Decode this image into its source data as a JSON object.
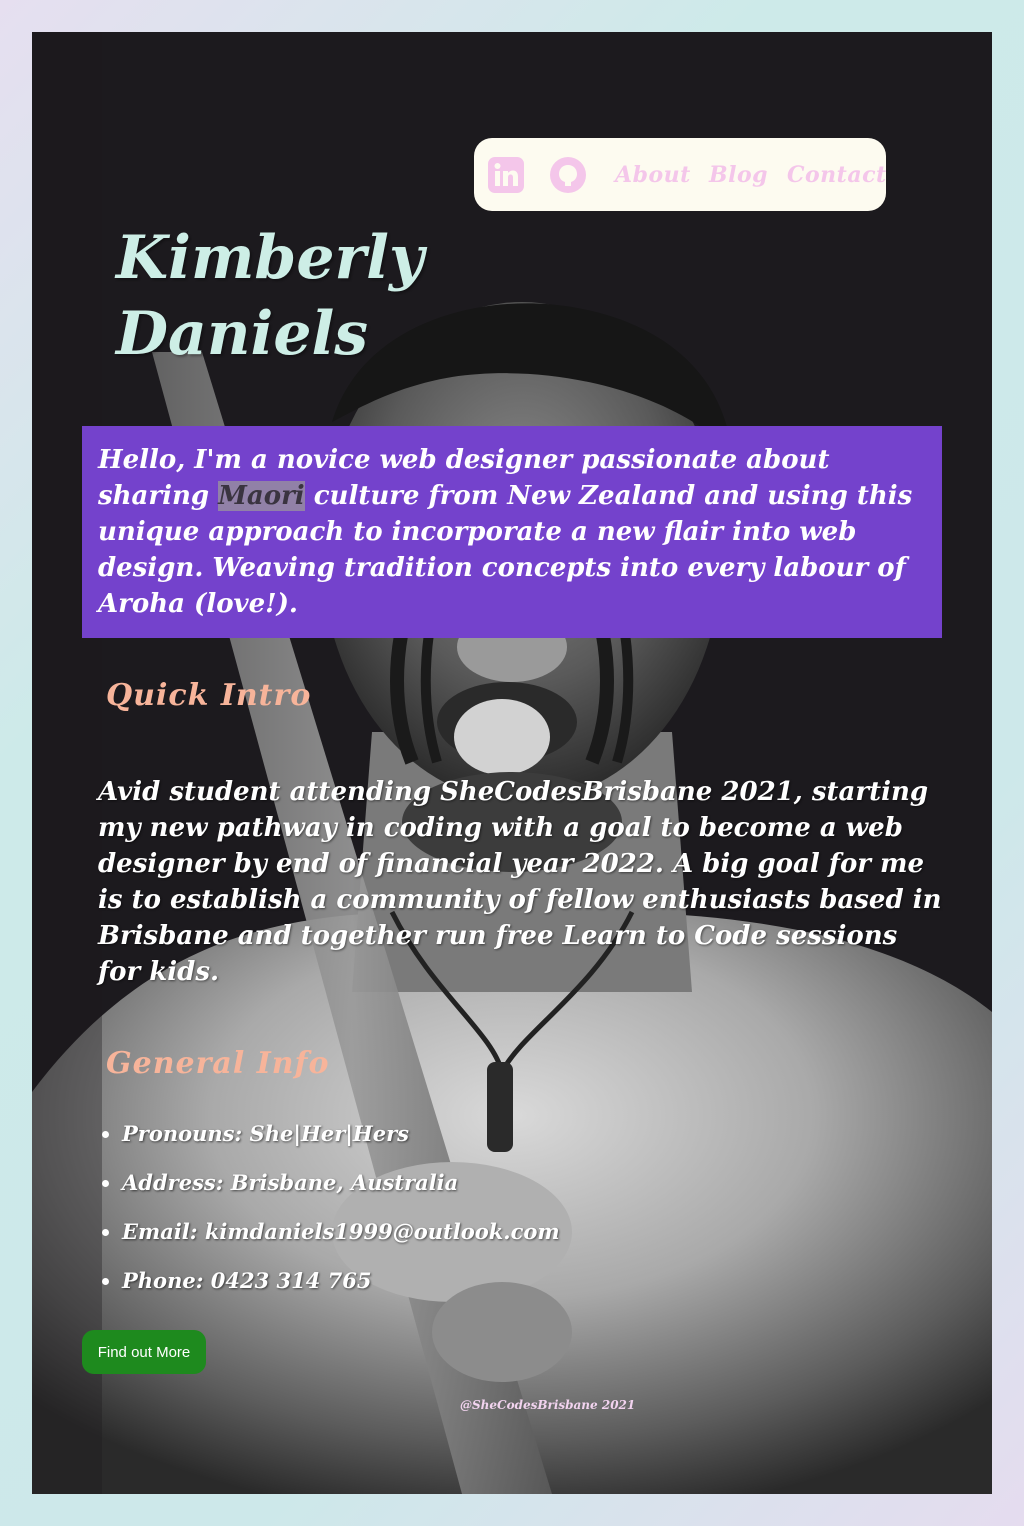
{
  "nav": {
    "linkedin_icon": "linkedin-icon",
    "github_icon": "github-icon",
    "links": [
      {
        "label": "About"
      },
      {
        "label": "Blog"
      },
      {
        "label": "Contact"
      }
    ]
  },
  "hero": {
    "name_line1": "Kimberly",
    "name_line2": "Daniels"
  },
  "intro_box": {
    "text_before": "Hello, I'm a novice web designer passionate about sharing ",
    "highlight": "Maori",
    "text_after": " culture from New Zealand and using this unique approach to incorporate a new flair into web design. Weaving tradition concepts into every labour of Aroha (love!)."
  },
  "quick_intro": {
    "heading": "Quick Intro",
    "body": "Avid student attending SheCodesBrisbane 2021, starting my new pathway in coding with a goal to become a web designer by end of financial year 2022. A big goal for me is to establish a community of fellow enthusiasts based in Brisbane and together run free Learn to Code sessions for kids."
  },
  "general_info": {
    "heading": "General Info",
    "items": [
      "Pronouns: She|Her|Hers",
      "Address: Brisbane, Australia",
      "Email: kimdaniels1999@outlook.com",
      "Phone: 0423 314 765"
    ]
  },
  "cta": {
    "label": "Find out More"
  },
  "footer": {
    "text": "@SheCodesBrisbane 2021"
  },
  "colors": {
    "card_bg": "#1c1a1e",
    "nav_bg": "#fdfbf0",
    "nav_link": "#f4c6ea",
    "name": "#cdeee6",
    "intro_box": "#7442cc",
    "heading": "#f7b49a",
    "button": "#1e8a1e"
  }
}
